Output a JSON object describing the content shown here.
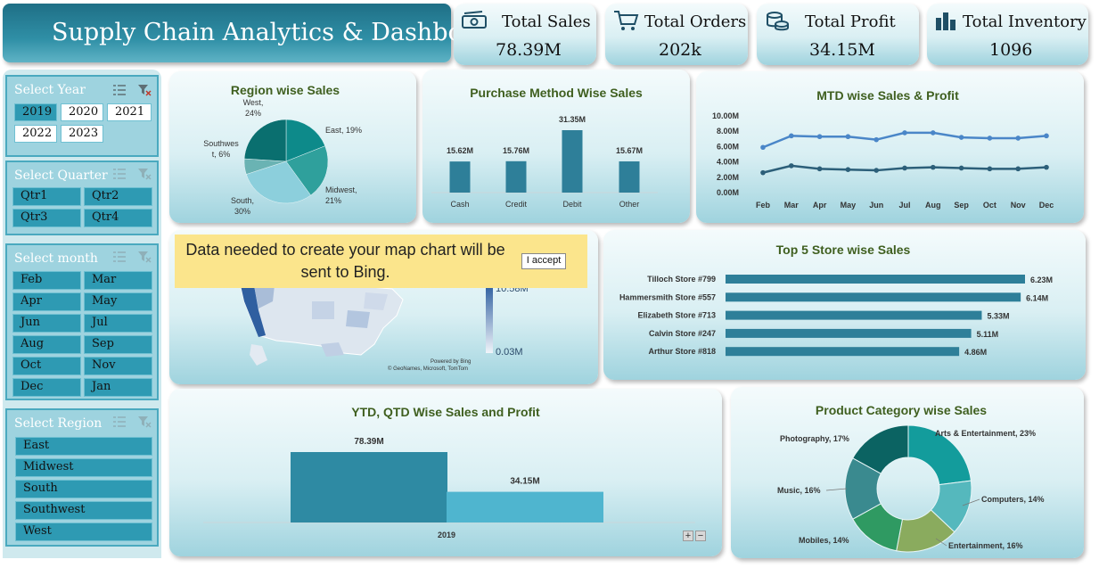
{
  "title": "Supply Chain Analytics & Dashboard",
  "kpis": [
    {
      "label": "Total Sales",
      "value": "78.39M",
      "icon": "money-icon"
    },
    {
      "label": "Total Orders",
      "value": "202k",
      "icon": "cart-icon"
    },
    {
      "label": "Total Profit",
      "value": "34.15M",
      "icon": "coins-icon"
    },
    {
      "label": "Total Inventory",
      "value": "1096",
      "icon": "warehouse-icon"
    }
  ],
  "slicers": {
    "year": {
      "header": "Select Year",
      "items": [
        "2019",
        "2020",
        "2021",
        "2022",
        "2023"
      ],
      "selected": "2019"
    },
    "quarter": {
      "header": "Select Quarter",
      "items": [
        "Qtr1",
        "Qtr2",
        "Qtr3",
        "Qtr4"
      ]
    },
    "month": {
      "header": "Select month",
      "items": [
        "Feb",
        "Mar",
        "Apr",
        "May",
        "Jun",
        "Jul",
        "Aug",
        "Sep",
        "Oct",
        "Nov",
        "Dec",
        "Jan"
      ]
    },
    "region": {
      "header": "Select Region",
      "items": [
        "East",
        "Midwest",
        "South",
        "Southwest",
        "West"
      ]
    }
  },
  "map": {
    "notice": "Data needed to create your map chart will be sent to Bing.",
    "accept": "I accept",
    "legend_high": "10.58M",
    "legend_low": "0.03M",
    "powered_by": "Powered by Bing",
    "credits": "© GeoNames, Microsoft, TomTom"
  },
  "zoom": {
    "plus": "+",
    "minus": "−"
  },
  "colors": {
    "accent": "#2e7f99",
    "title_green": "#3f5f1f",
    "notice": "#fbe58c"
  },
  "chart_data": [
    {
      "id": "region",
      "type": "pie",
      "title": "Region wise Sales",
      "labels": [
        "East",
        "Midwest",
        "South",
        "Southwest",
        "West"
      ],
      "values": [
        19,
        21,
        30,
        6,
        24
      ],
      "data_labels": [
        "East, 19%",
        "Midwest, 21%",
        "South, 30%",
        "Southwest, 6%",
        "West, 24%"
      ],
      "colors": [
        "#0d8a8a",
        "#2fa09c",
        "#8ccfdc",
        "#6ab3b3",
        "#0a6f6f"
      ]
    },
    {
      "id": "purchase",
      "type": "bar",
      "title": "Purchase Method Wise Sales",
      "categories": [
        "Cash",
        "Credit",
        "Debit",
        "Other"
      ],
      "values": [
        15.62,
        15.76,
        31.35,
        15.67
      ],
      "data_labels": [
        "15.62M",
        "15.76M",
        "31.35M",
        "15.67M"
      ],
      "unit": "M"
    },
    {
      "id": "mtd",
      "type": "line",
      "title": "MTD wise Sales & Profit",
      "categories": [
        "Feb",
        "Mar",
        "Apr",
        "May",
        "Jun",
        "Jul",
        "Aug",
        "Sep",
        "Oct",
        "Nov",
        "Dec"
      ],
      "series": [
        {
          "values": [
            5.9,
            7.4,
            7.3,
            7.3,
            6.9,
            7.8,
            7.8,
            7.2,
            7.1,
            7.1,
            7.4
          ],
          "color": "#4a86c8"
        },
        {
          "values": [
            2.6,
            3.5,
            3.1,
            3.0,
            2.9,
            3.2,
            3.3,
            3.2,
            3.1,
            3.1,
            3.3
          ],
          "color": "#2c5f79"
        }
      ],
      "ylim": [
        0,
        10
      ],
      "yticks": [
        "0.00M",
        "2.00M",
        "4.00M",
        "6.00M",
        "8.00M",
        "10.00M"
      ]
    },
    {
      "id": "stores",
      "type": "bar",
      "title": "Top 5 Store wise Sales",
      "categories": [
        "Tilloch Store #799",
        "Hammersmith Store #557",
        "Elizabeth Store #713",
        "Calvin Store #247",
        "Arthur Store #818"
      ],
      "values": [
        6.23,
        6.14,
        5.33,
        5.11,
        4.86
      ],
      "data_labels": [
        "6.23M",
        "6.14M",
        "5.33M",
        "5.11M",
        "4.86M"
      ]
    },
    {
      "id": "ytd",
      "type": "bar",
      "title": "YTD, QTD Wise Sales and Profit",
      "categories": [
        "2019"
      ],
      "series": [
        {
          "values": [
            78.39
          ],
          "data_label": "78.39M",
          "color": "#2e8aa3"
        },
        {
          "values": [
            34.15
          ],
          "data_label": "34.15M",
          "color": "#4fb5cf"
        }
      ]
    },
    {
      "id": "category",
      "type": "pie",
      "title": "Product Category wise Sales",
      "labels": [
        "Arts & Entertainment",
        "Computers",
        "Entertainment",
        "Mobiles",
        "Music",
        "Photography"
      ],
      "values": [
        23,
        14,
        16,
        14,
        16,
        17
      ],
      "data_labels": [
        "Arts & Entertainment, 23%",
        "Computers, 14%",
        "Entertainment, 16%",
        "Mobiles, 14%",
        "Music, 16%",
        "Photography, 17%"
      ],
      "colors": [
        "#139c9c",
        "#55b8bd",
        "#8aab5e",
        "#2f9a62",
        "#3a8a8f",
        "#0b6362"
      ]
    }
  ]
}
